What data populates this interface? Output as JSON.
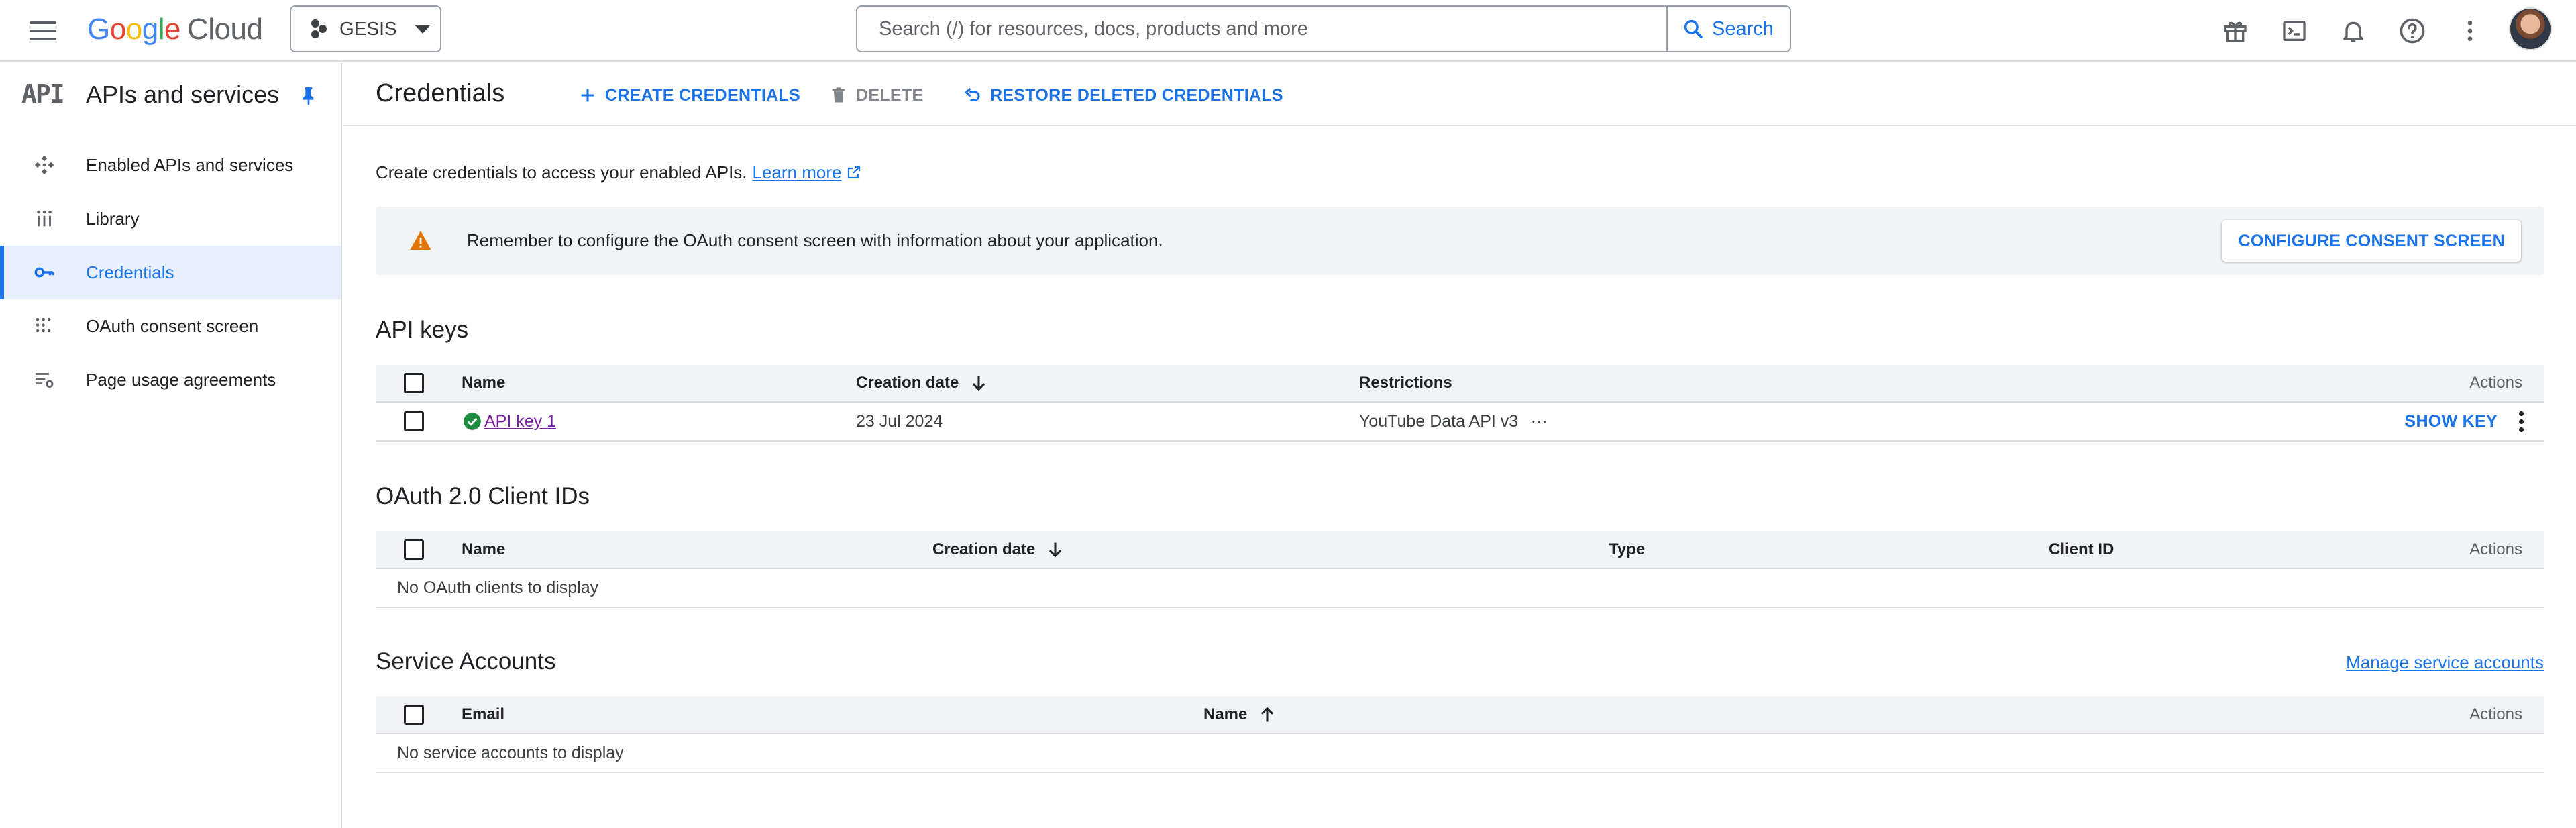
{
  "topbar": {
    "logo_google": [
      "G",
      "o",
      "o",
      "g",
      "l",
      "e"
    ],
    "logo_cloud": "Cloud",
    "project_name": "GESIS",
    "search_placeholder": "Search (/) for resources, docs, products and more",
    "search_button": "Search",
    "icons": [
      "gift-icon",
      "cloud-shell-icon",
      "bell-icon",
      "help-icon",
      "more-vert-icon",
      "avatar"
    ]
  },
  "sidebar": {
    "logo_text": "API",
    "title": "APIs and services",
    "items": [
      {
        "label": "Enabled APIs and services",
        "icon": "enabled-apis-icon",
        "active": false
      },
      {
        "label": "Library",
        "icon": "library-icon",
        "active": false
      },
      {
        "label": "Credentials",
        "icon": "key-icon",
        "active": true
      },
      {
        "label": "OAuth consent screen",
        "icon": "oauth-icon",
        "active": false
      },
      {
        "label": "Page usage agreements",
        "icon": "settings-list-icon",
        "active": false
      }
    ]
  },
  "header": {
    "title": "Credentials",
    "create_label": "CREATE CREDENTIALS",
    "delete_label": "DELETE",
    "restore_label": "RESTORE DELETED CREDENTIALS"
  },
  "intro": {
    "text": "Create credentials to access your enabled APIs.",
    "link": "Learn more"
  },
  "banner": {
    "text": "Remember to configure the OAuth consent screen with information about your application.",
    "button": "CONFIGURE CONSENT SCREEN"
  },
  "api_keys": {
    "title": "API keys",
    "columns": {
      "name": "Name",
      "date": "Creation date",
      "restrictions": "Restrictions",
      "actions": "Actions"
    },
    "rows": [
      {
        "name": "API key 1",
        "date": "23 Jul 2024",
        "restrictions": "YouTube Data API v3",
        "more": "···",
        "action": "SHOW KEY"
      }
    ]
  },
  "oauth": {
    "title": "OAuth 2.0 Client IDs",
    "columns": {
      "name": "Name",
      "date": "Creation date",
      "type": "Type",
      "client_id": "Client ID",
      "actions": "Actions"
    },
    "empty": "No OAuth clients to display"
  },
  "service_accounts": {
    "title": "Service Accounts",
    "manage_link": "Manage service accounts",
    "columns": {
      "email": "Email",
      "name": "Name",
      "actions": "Actions"
    },
    "empty": "No service accounts to display"
  },
  "colors": {
    "accent": "#1a73e8",
    "warning": "#e37400",
    "success": "#1e8e3e",
    "visited_link": "#7b1fa2",
    "active_nav_bg": "#e8f0fe"
  }
}
